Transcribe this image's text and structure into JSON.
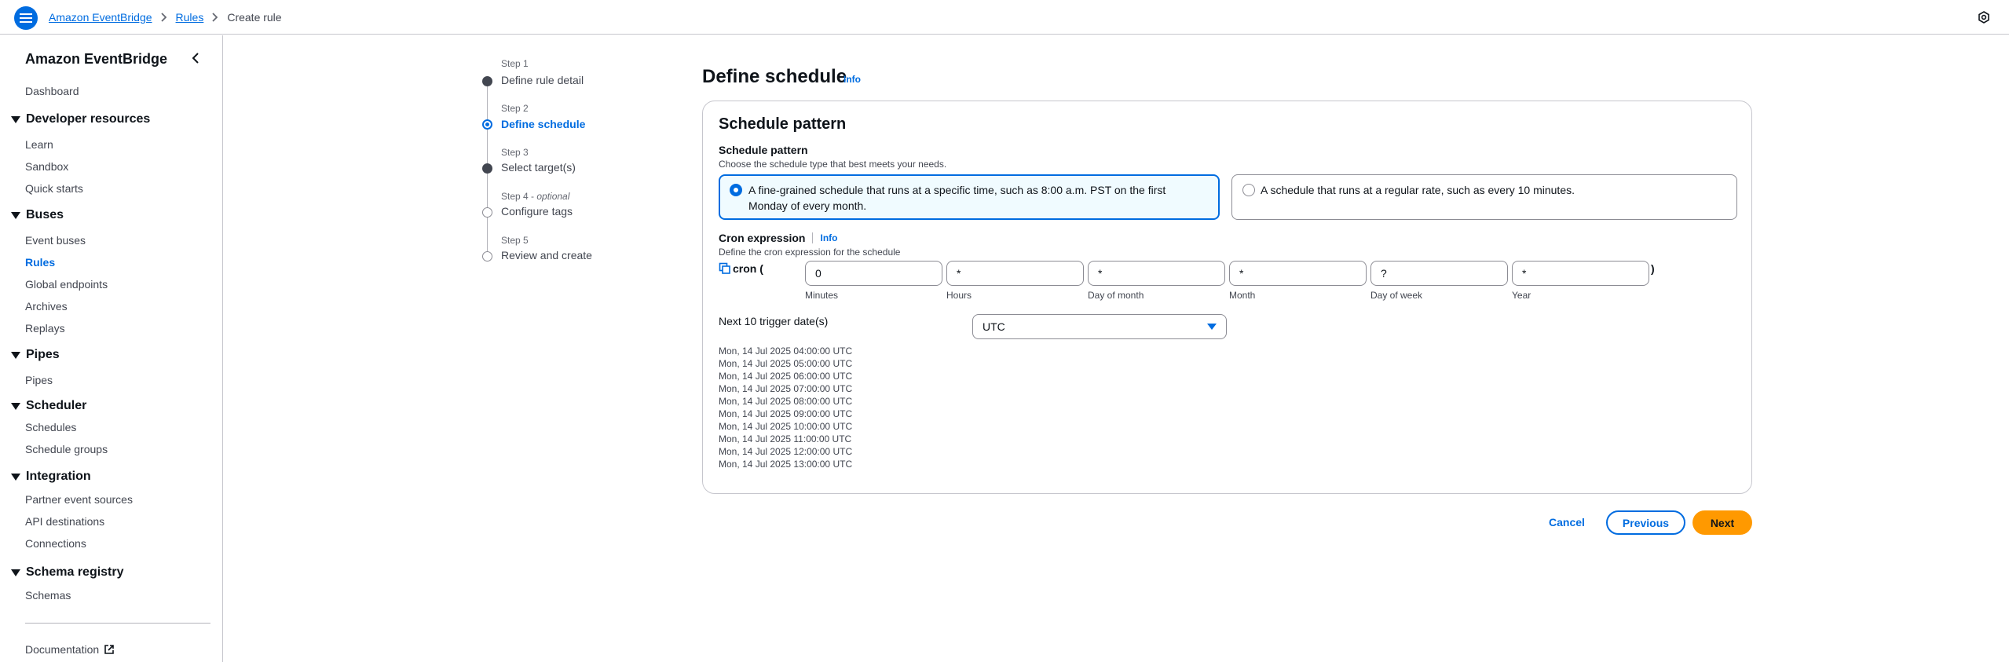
{
  "breadcrumb": {
    "root": "Amazon EventBridge",
    "parent": "Rules",
    "current": "Create rule"
  },
  "icons": {
    "menu": "hamburger-menu-icon",
    "settings": "settings-icon",
    "collapse": "chevron-left-icon",
    "external": "external-link-icon",
    "copy": "copy-icon",
    "dropdown": "caret-down-icon"
  },
  "sidebar": {
    "title": "Amazon EventBridge",
    "dashboard": "Dashboard",
    "sections": [
      {
        "label": "Developer resources",
        "items": [
          "Learn",
          "Sandbox",
          "Quick starts"
        ]
      },
      {
        "label": "Buses",
        "items": [
          "Event buses",
          "Rules",
          "Global endpoints",
          "Archives",
          "Replays"
        ]
      },
      {
        "label": "Pipes",
        "items": [
          "Pipes"
        ]
      },
      {
        "label": "Scheduler",
        "items": [
          "Schedules",
          "Schedule groups"
        ]
      },
      {
        "label": "Integration",
        "items": [
          "Partner event sources",
          "API destinations",
          "Connections"
        ]
      },
      {
        "label": "Schema registry",
        "items": [
          "Schemas"
        ]
      }
    ],
    "active_item": "Rules",
    "documentation": "Documentation"
  },
  "steps": [
    {
      "small": "Step 1",
      "optional": "",
      "label": "Define rule detail",
      "state": "done"
    },
    {
      "small": "Step 2",
      "optional": "",
      "label": "Define schedule",
      "state": "active"
    },
    {
      "small": "Step 3",
      "optional": "",
      "label": "Select target(s)",
      "state": "done"
    },
    {
      "small": "Step 4 - ",
      "optional": "optional",
      "label": "Configure tags",
      "state": "todo"
    },
    {
      "small": "Step 5",
      "optional": "",
      "label": "Review and create",
      "state": "todo"
    }
  ],
  "main": {
    "title": "Define schedule",
    "info": "Info",
    "panel_title": "Schedule pattern",
    "pattern_label": "Schedule pattern",
    "pattern_desc": "Choose the schedule type that best meets your needs.",
    "option_cron_line1": "A fine-grained schedule that runs at a specific time, such as 8:00 a.m. PST on the first",
    "option_cron_line2": "Monday of every month.",
    "option_rate": "A schedule that runs at a regular rate, such as every 10 minutes.",
    "cron_label": "Cron expression",
    "cron_info": "Info",
    "cron_desc": "Define the cron expression for the schedule",
    "cron_prefix": "cron (",
    "cron_suffix": ")",
    "cron_fields": [
      {
        "value": "0",
        "caption": "Minutes"
      },
      {
        "value": "*",
        "caption": "Hours"
      },
      {
        "value": "*",
        "caption": "Day of month"
      },
      {
        "value": "*",
        "caption": "Month"
      },
      {
        "value": "?",
        "caption": "Day of week"
      },
      {
        "value": "*",
        "caption": "Year"
      }
    ],
    "next_label": "Next 10 trigger date(s)",
    "timezone": "UTC",
    "trigger_dates": [
      "Mon, 14 Jul 2025 04:00:00 UTC",
      "Mon, 14 Jul 2025 05:00:00 UTC",
      "Mon, 14 Jul 2025 06:00:00 UTC",
      "Mon, 14 Jul 2025 07:00:00 UTC",
      "Mon, 14 Jul 2025 08:00:00 UTC",
      "Mon, 14 Jul 2025 09:00:00 UTC",
      "Mon, 14 Jul 2025 10:00:00 UTC",
      "Mon, 14 Jul 2025 11:00:00 UTC",
      "Mon, 14 Jul 2025 12:00:00 UTC",
      "Mon, 14 Jul 2025 13:00:00 UTC"
    ]
  },
  "actions": {
    "cancel": "Cancel",
    "previous": "Previous",
    "next": "Next"
  },
  "colors": {
    "accent": "#006ce0",
    "primary_button": "#ff9900",
    "selected_tile_bg": "#f0fbff"
  }
}
